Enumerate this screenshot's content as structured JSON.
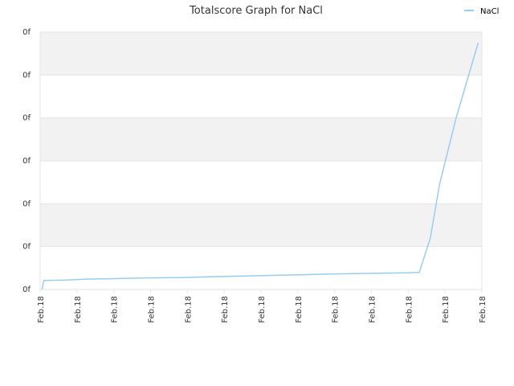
{
  "chart_data": {
    "type": "line",
    "title": "Totalscore Graph for NaCl",
    "xlabel": "",
    "ylabel": "",
    "x_tick_labels": [
      "Feb.18",
      "Feb.18",
      "Feb.18",
      "Feb.18",
      "Feb.18",
      "Feb.18",
      "Feb.18",
      "Feb.18",
      "Feb.18",
      "Feb.18",
      "Feb.18",
      "Feb.18",
      "Feb.18"
    ],
    "y_tick_labels": [
      "0f",
      "0f",
      "0f",
      "0f",
      "0f",
      "0f",
      "0f"
    ],
    "xlim": [
      0,
      12
    ],
    "ylim": [
      0,
      6
    ],
    "grid": true,
    "legend_position": "top-right",
    "colors": {
      "line": "#99ccf0",
      "band": "#f2f2f2",
      "grid": "#e4e4e4"
    },
    "series": [
      {
        "name": "NaCl",
        "x": [
          0.05,
          0.1,
          0.7,
          1.2,
          1.8,
          2.8,
          3.8,
          4.8,
          5.9,
          6.9,
          7.9,
          9.2,
          10.0,
          10.3,
          10.6,
          10.85,
          11.3,
          11.9
        ],
        "y": [
          0.0,
          0.21,
          0.22,
          0.24,
          0.25,
          0.27,
          0.28,
          0.3,
          0.32,
          0.34,
          0.36,
          0.38,
          0.39,
          0.4,
          1.2,
          2.45,
          4.0,
          5.75
        ]
      }
    ]
  }
}
